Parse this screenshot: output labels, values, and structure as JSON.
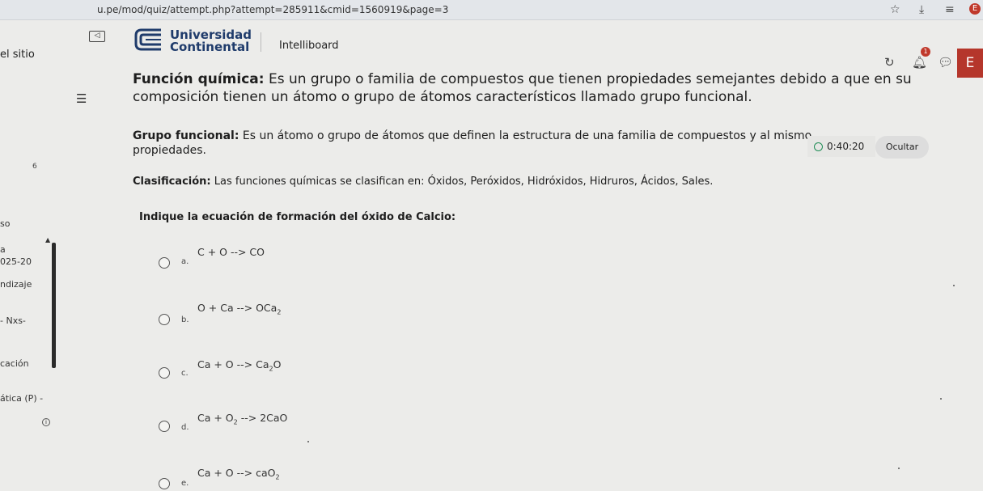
{
  "browser": {
    "url": "u.pe/mod/quiz/attempt.php?attempt=285911&cmid=1560919&page=3",
    "profile_letter": "E"
  },
  "sidebar": {
    "site_label": "el sitio",
    "section_number": "6",
    "fragments": [
      "so",
      "a",
      "025-20",
      "ndizaje",
      "- Nxs-",
      "cación",
      "ática (P) -"
    ]
  },
  "header": {
    "logo_line1": "Universidad",
    "logo_line2": "Continental",
    "nav_link": "Intelliboard",
    "notification_count": "1",
    "user_initial": "E",
    "brand_color": "#1f3b6b"
  },
  "content": {
    "p1_term": "Función química:",
    "p1_text": " Es un grupo o familia de compuestos que tienen propiedades semejantes debido a que en su composición tienen un átomo o grupo de átomos característicos llamado grupo funcional.",
    "p2_term": "Grupo funcional:",
    "p2_text": " Es un átomo o grupo de átomos que definen la estructura de una familia de compuestos y al mismo propiedades.",
    "p3_term": "Clasificación:",
    "p3_text": " Las funciones químicas se clasifican en: Óxidos, Peróxidos, Hidróxidos, Hidruros, Ácidos, Sales.",
    "question": "Indique la ecuación de formación del óxido de Calcio:"
  },
  "timer": {
    "value": "0:40:20",
    "hide_label": "Ocultar"
  },
  "options": [
    {
      "letter": "a.",
      "lhs": "C + O --> CO",
      "sub": "",
      "tail": ""
    },
    {
      "letter": "b.",
      "lhs": "O + Ca --> OCa",
      "sub": "2",
      "tail": ""
    },
    {
      "letter": "c.",
      "lhs": "Ca + O --> Ca",
      "sub": "2",
      "tail": "O"
    },
    {
      "letter": "d.",
      "lhs": "Ca + O",
      "sub": "2",
      "tail": " --> 2CaO"
    },
    {
      "letter": "e.",
      "lhs": "Ca + O --> caO",
      "sub": "2",
      "tail": ""
    }
  ]
}
